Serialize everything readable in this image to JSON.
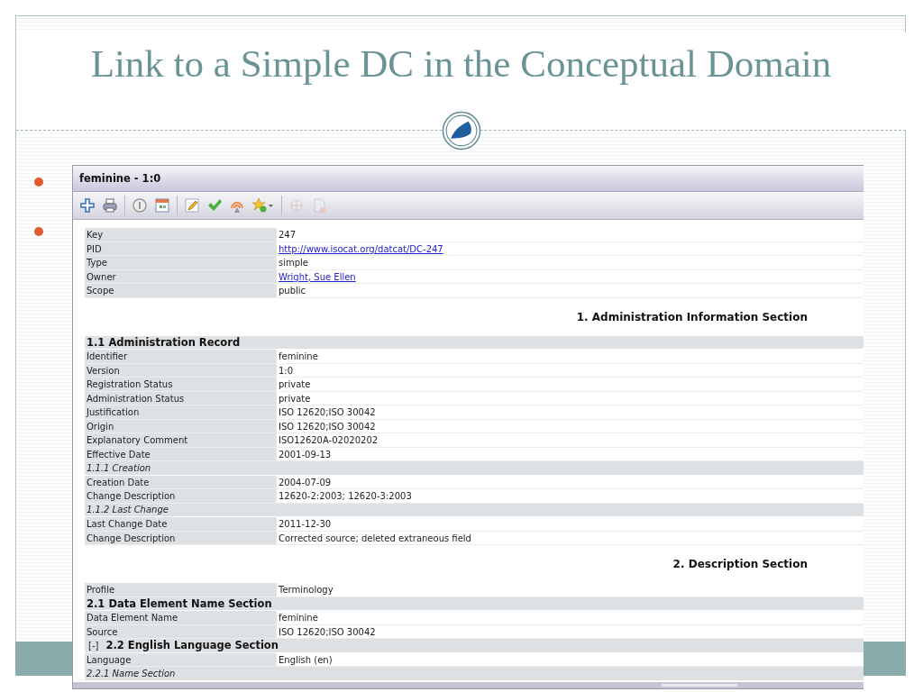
{
  "slide": {
    "title": "Link to a Simple DC in the Conceptual Domain"
  },
  "window": {
    "title": "feminine - 1:0"
  },
  "toolbar": [
    {
      "kind": "plus",
      "disabled": false
    },
    {
      "kind": "printer",
      "disabled": false
    },
    {
      "kind": "separator"
    },
    {
      "kind": "info",
      "disabled": false
    },
    {
      "kind": "calendar",
      "disabled": false
    },
    {
      "kind": "separator"
    },
    {
      "kind": "pencil",
      "disabled": false
    },
    {
      "kind": "check",
      "disabled": false
    },
    {
      "kind": "signal",
      "disabled": false
    },
    {
      "kind": "star",
      "disabled": false
    },
    {
      "kind": "separator"
    },
    {
      "kind": "globe",
      "disabled": true
    },
    {
      "kind": "document",
      "disabled": true
    }
  ],
  "rows": [
    {
      "kind": "field",
      "label": "Key",
      "value": "247"
    },
    {
      "kind": "link",
      "label": "PID",
      "value": "http://www.isocat.org/datcat/DC-247"
    },
    {
      "kind": "field",
      "label": "Type",
      "value": "simple"
    },
    {
      "kind": "link",
      "label": "Owner",
      "value": "Wright, Sue Ellen"
    },
    {
      "kind": "field",
      "label": "Scope",
      "value": "public"
    },
    {
      "kind": "section",
      "label": "1. Administration Information Section"
    },
    {
      "kind": "group",
      "label": "1.1 Administration Record"
    },
    {
      "kind": "field",
      "label": "Identifier",
      "value": "feminine"
    },
    {
      "kind": "field",
      "label": "Version",
      "value": "1:0"
    },
    {
      "kind": "field",
      "label": "Registration Status",
      "value": "private"
    },
    {
      "kind": "field",
      "label": "Administration Status",
      "value": "private"
    },
    {
      "kind": "field",
      "label": "Justification",
      "value": "ISO 12620;ISO 30042"
    },
    {
      "kind": "field",
      "label": "Origin",
      "value": "ISO 12620;ISO 30042"
    },
    {
      "kind": "field",
      "label": "Explanatory Comment",
      "value": "ISO12620A-02020202"
    },
    {
      "kind": "field",
      "label": "Effective Date",
      "value": "2001-09-13"
    },
    {
      "kind": "subgroup",
      "label": "1.1.1 Creation"
    },
    {
      "kind": "field",
      "label": "Creation Date",
      "value": "2004-07-09"
    },
    {
      "kind": "field",
      "label": "Change Description",
      "value": "12620-2:2003; 12620-3:2003"
    },
    {
      "kind": "subgroup",
      "label": "1.1.2 Last Change"
    },
    {
      "kind": "field",
      "label": "Last Change Date",
      "value": "2011-12-30"
    },
    {
      "kind": "field",
      "label": "Change Description",
      "value": "Corrected source; deleted extraneous field"
    },
    {
      "kind": "section",
      "label": "2. Description Section"
    },
    {
      "kind": "field",
      "label": "Profile",
      "value": "Terminology"
    },
    {
      "kind": "group",
      "label": "2.1 Data Element Name Section"
    },
    {
      "kind": "field",
      "label": "Data Element Name",
      "value": "feminine"
    },
    {
      "kind": "field",
      "label": "Source",
      "value": "ISO 12620;ISO 30042"
    },
    {
      "kind": "group",
      "toggle": "[-]",
      "label": "2.2 English Language Section"
    },
    {
      "kind": "field",
      "label": "Language",
      "value": "English (en)"
    },
    {
      "kind": "subgroup",
      "label": "2.2.1 Name Section"
    }
  ]
}
